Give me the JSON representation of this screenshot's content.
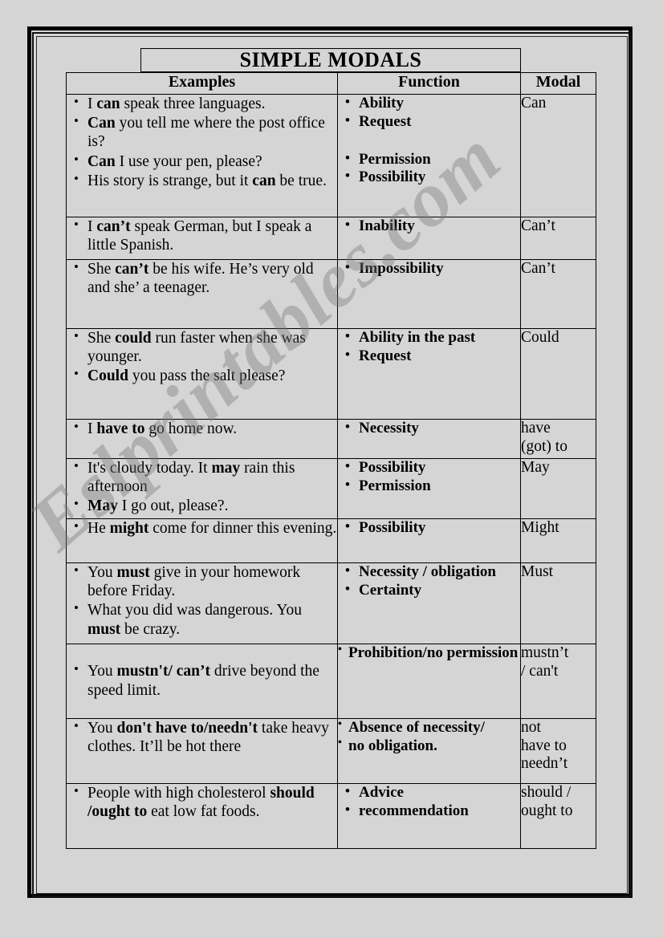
{
  "worksheet": {
    "title": "SIMPLE MODALS",
    "watermark": "Eslprintables.com",
    "headers": {
      "examples": "Examples",
      "function": "Function",
      "modal": "Modal"
    },
    "rows": [
      {
        "examples": [
          "I can speak three languages.",
          "Can you tell me where the post office is?",
          "Can I use your pen, please?",
          "His story is strange, but it can be true."
        ],
        "functions": [
          "Ability",
          "Request",
          "Permission",
          "Possibility"
        ],
        "modal": "Can"
      },
      {
        "examples": [
          "I can’t speak German, but I speak a little Spanish."
        ],
        "functions": [
          "Inability"
        ],
        "modal": "Can’t"
      },
      {
        "examples": [
          "She can’t be his wife. He’s very old and she’ a teenager."
        ],
        "functions": [
          "Impossibility"
        ],
        "modal": "Can’t"
      },
      {
        "examples": [
          "She could run faster when she was younger.",
          "Could you pass the salt please?"
        ],
        "functions": [
          "Ability in the past",
          "Request"
        ],
        "modal": "Could"
      },
      {
        "examples": [
          "I have to go home now."
        ],
        "functions": [
          "Necessity"
        ],
        "modal": "have\n(got) to"
      },
      {
        "examples": [
          "It's cloudy today. It may rain this afternoon",
          "May I go out, please?."
        ],
        "functions": [
          "Possibility",
          "Permission"
        ],
        "modal": "May"
      },
      {
        "examples": [
          "He might come for dinner this evening."
        ],
        "functions": [
          "Possibility"
        ],
        "modal": "Might"
      },
      {
        "examples": [
          "You must give in your homework before Friday.",
          "What you did was dangerous. You must be crazy."
        ],
        "functions": [
          "Necessity / obligation",
          "Certainty"
        ],
        "modal": "Must"
      },
      {
        "examples": [
          "You mustn't/ can’t drive beyond the speed limit."
        ],
        "functions": [
          "Prohibition/no permission"
        ],
        "modal": "mustn’t\n/ can't"
      },
      {
        "examples": [
          "You don't have to/needn't take heavy clothes. It’ll be hot there"
        ],
        "functions": [
          "Absence of necessity/",
          "no obligation."
        ],
        "modal": "not\nhave to\nneedn’t"
      },
      {
        "examples": [
          "People with high cholesterol should /ought to eat low fat foods."
        ],
        "functions": [
          "Advice",
          "recommendation"
        ],
        "modal": "should /\nought to"
      }
    ]
  }
}
